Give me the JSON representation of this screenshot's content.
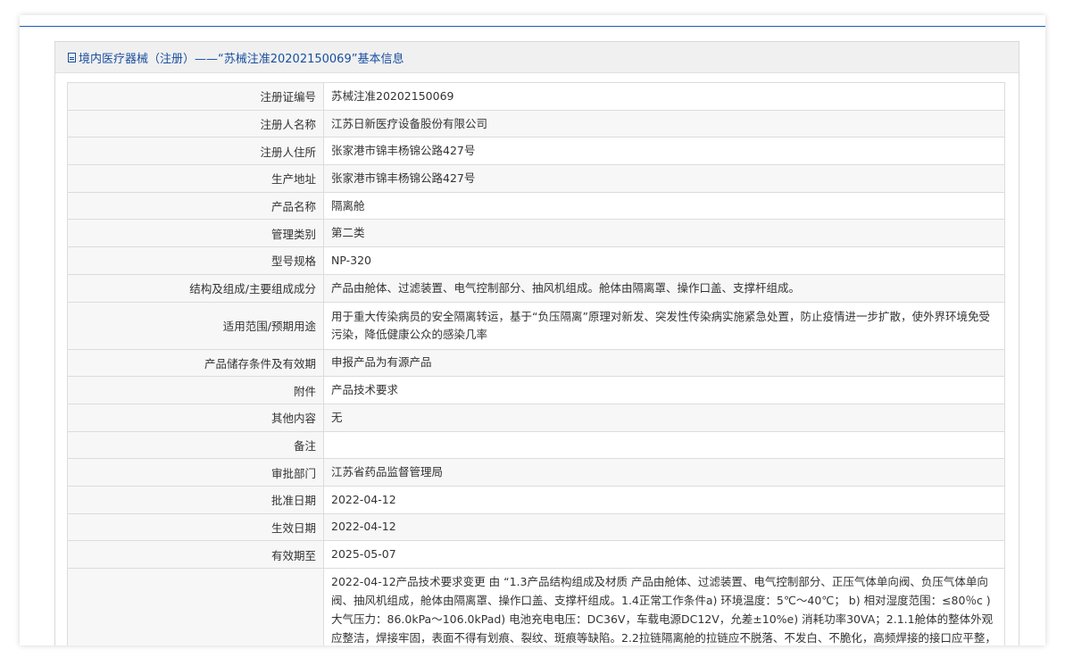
{
  "header": {
    "title": "境内医疗器械（注册）——“苏械注准20202150069”基本信息",
    "icon": "document-icon"
  },
  "rows": [
    {
      "label": "注册证编号",
      "value": "苏械注准20202150069"
    },
    {
      "label": "注册人名称",
      "value": "江苏日新医疗设备股份有限公司"
    },
    {
      "label": "注册人住所",
      "value": "张家港市锦丰杨锦公路427号"
    },
    {
      "label": "生产地址",
      "value": "张家港市锦丰杨锦公路427号"
    },
    {
      "label": "产品名称",
      "value": "隔离舱"
    },
    {
      "label": "管理类别",
      "value": "第二类"
    },
    {
      "label": "型号规格",
      "value": "NP-320"
    },
    {
      "label": "结构及组成/主要组成成分",
      "value": "产品由舱体、过滤装置、电气控制部分、抽风机组成。舱体由隔离罩、操作口盖、支撑杆组成。"
    },
    {
      "label": "适用范围/预期用途",
      "value": "用于重大传染病员的安全隔离转运，基于“负压隔离”原理对新发、突发性传染病实施紧急处置，防止疫情进一步扩散，使外界环境免受污染，降低健康公众的感染几率"
    },
    {
      "label": "产品储存条件及有效期",
      "value": "申报产品为有源产品"
    },
    {
      "label": "附件",
      "value": "产品技术要求"
    },
    {
      "label": "其他内容",
      "value": "无"
    },
    {
      "label": "备注",
      "value": ""
    },
    {
      "label": "审批部门",
      "value": "江苏省药品监督管理局"
    },
    {
      "label": "批准日期",
      "value": "2022-04-12"
    },
    {
      "label": "生效日期",
      "value": "2022-04-12"
    },
    {
      "label": "有效期至",
      "value": "2025-05-07"
    },
    {
      "label": "",
      "value": "2022-04-12产品技术要求变更 由 “1.3产品结构组成及材质 产品由舱体、过滤装置、电气控制部分、正压气体单向阀、负压气体单向阀、抽风机组成，舱体由隔离罩、操作口盖、支撑杆组成。1.4正常工作条件a) 环境温度：5℃～40℃； b) 相对湿度范围：≤80％c ) 大气压力：86.0kPa～106.0kPad) 电池充电电压：DC36V，车载电源DC12V，允差±10%e) 消耗功率30VA；2.1.1舱体的整体外观应整洁，焊接牢固，表面不得有划痕、裂纹、斑痕等缺陷。2.2拉链隔离舱的拉链应不脱落、不发白、不脆化，高频焊接的接口应平整，"
    }
  ],
  "colors": {
    "accent": "#1a4fa0",
    "rule": "#1a5fb4",
    "label_bg": "#f7f7f7",
    "border": "#dcdcdc"
  }
}
